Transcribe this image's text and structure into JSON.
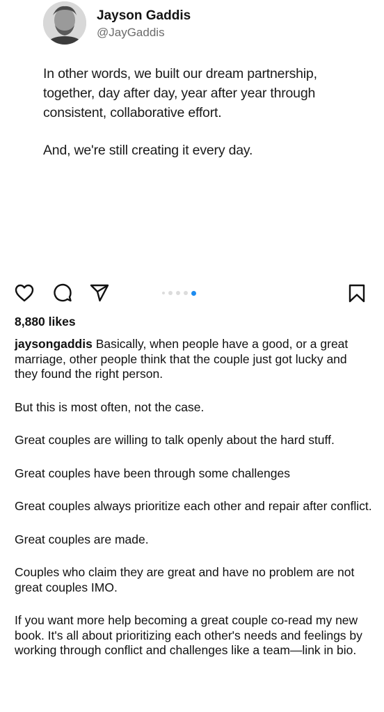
{
  "post": {
    "author_name": "Jayson Gaddis",
    "author_handle": "@JayGaddis",
    "paragraphs": [
      "In other words, we built our dream partnership, together, day after day, year after year through consistent, collaborative effort.",
      "And, we're still creating it every day."
    ]
  },
  "actions": {
    "icons": [
      "heart-icon",
      "comment-icon",
      "share-icon",
      "bookmark-icon"
    ],
    "carousel": {
      "count": 5,
      "active_index": 4,
      "active_color": "#1d8cf0"
    }
  },
  "likes_text": "8,880 likes",
  "caption": {
    "username": "jaysongaddis",
    "first_paragraph": "Basically, when people have a good, or a great marriage, other people think that the couple just got lucky and they found the right person.",
    "paragraphs": [
      "But this is most often, not the case.",
      "Great couples are willing to talk openly about the hard stuff.",
      "Great couples have been through some challenges",
      "Great couples always prioritize each other and repair after conflict.",
      "Great couples are made.",
      "Couples who claim they are great and have no problem are not great couples IMO.",
      "If you want more help becoming a great couple co-read my new book. It's all about prioritizing each other's needs and feelings by working through conflict and challenges like a team—link in bio."
    ]
  }
}
